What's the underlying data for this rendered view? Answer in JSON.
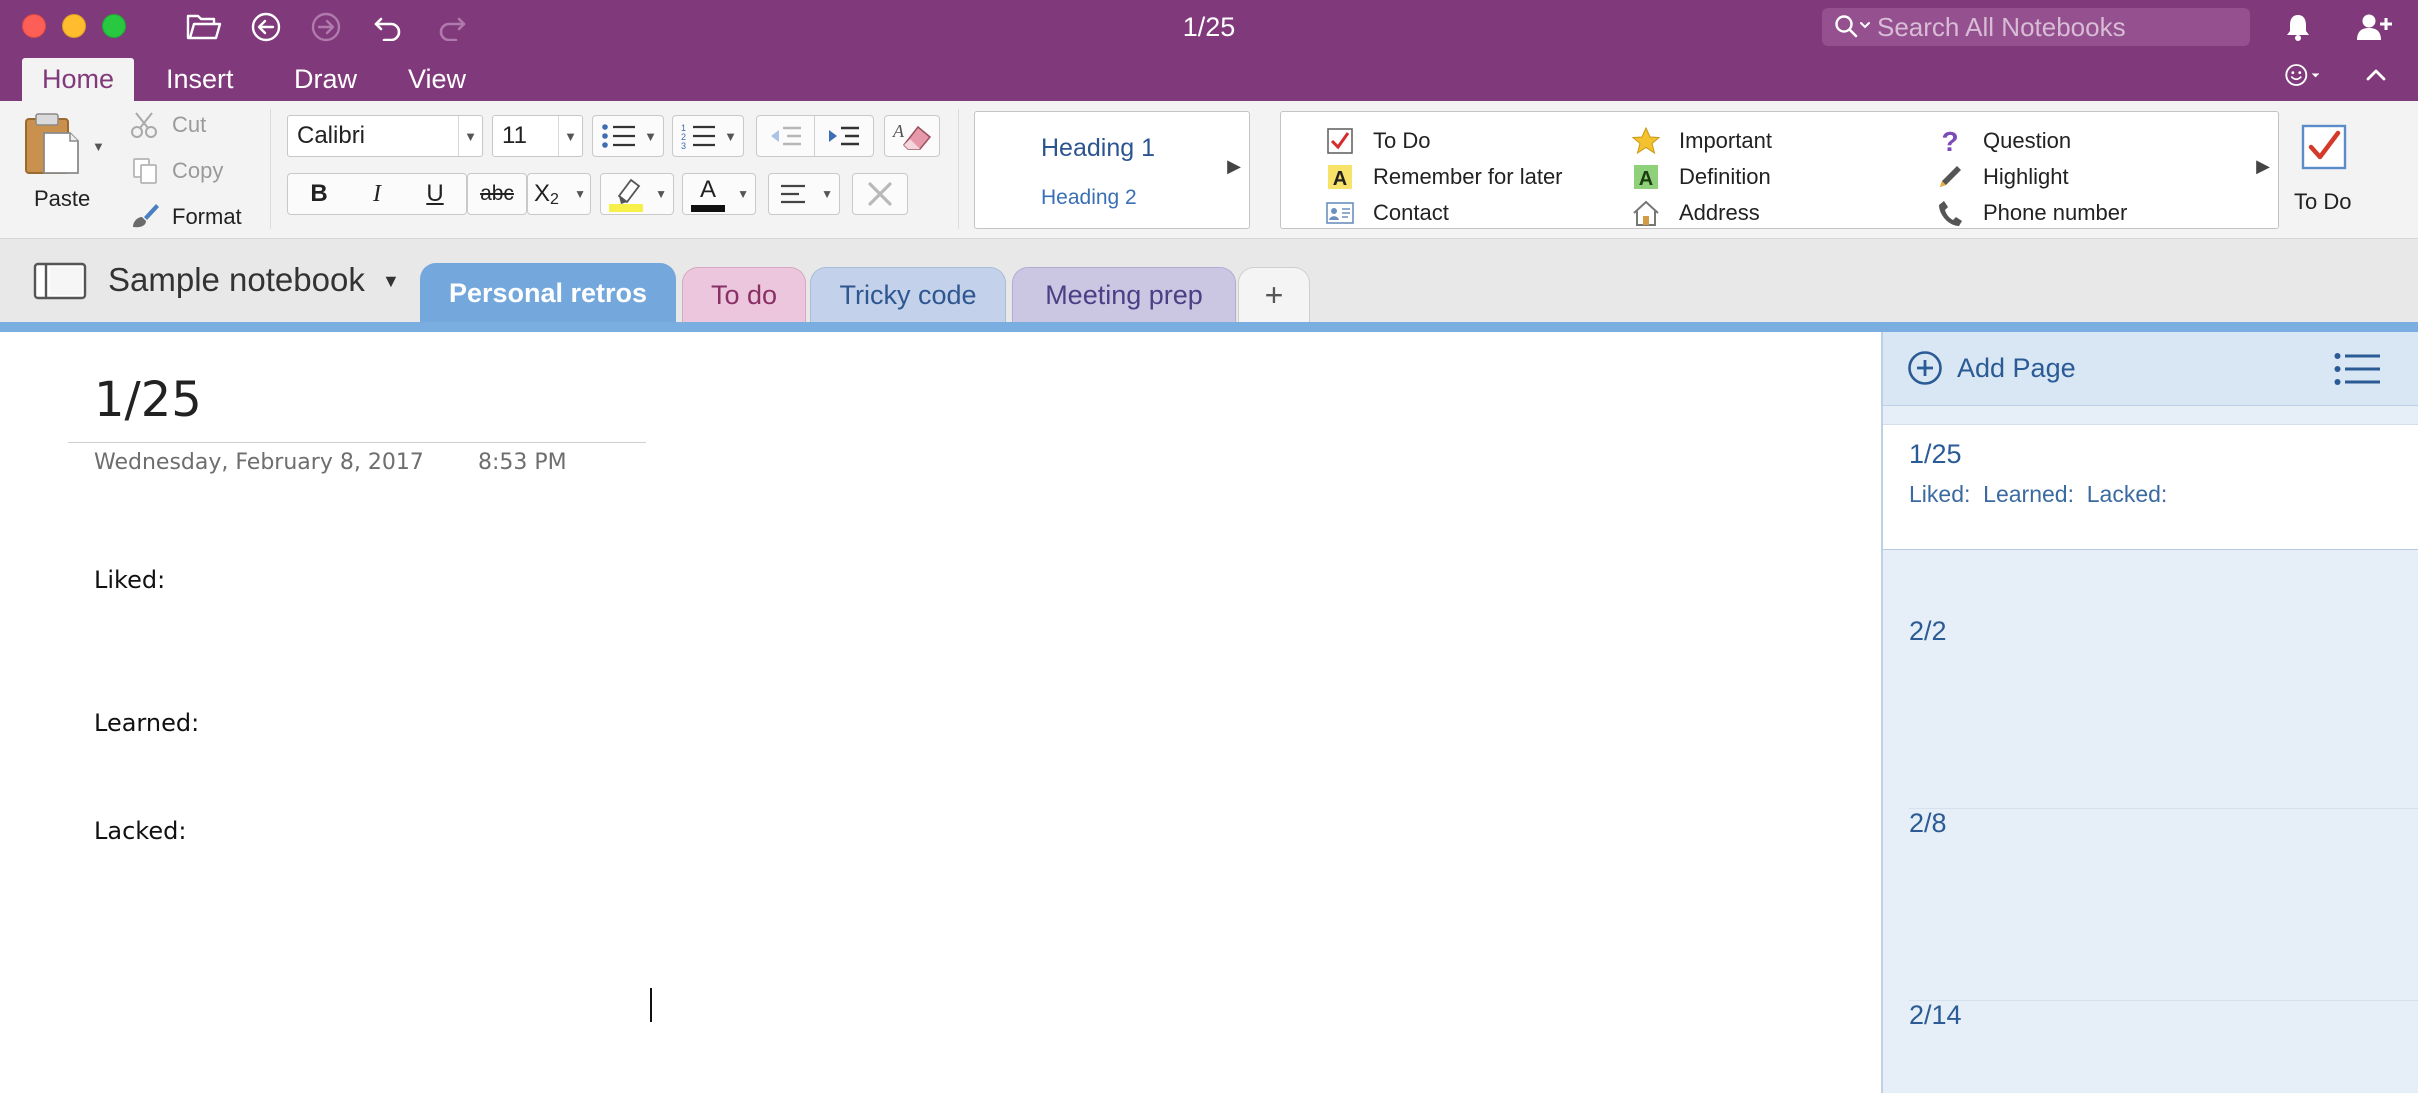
{
  "window": {
    "title": "1/25"
  },
  "search": {
    "placeholder": "Search All Notebooks"
  },
  "ribbon_tabs": [
    {
      "label": "Home",
      "active": true
    },
    {
      "label": "Insert",
      "active": false
    },
    {
      "label": "Draw",
      "active": false
    },
    {
      "label": "View",
      "active": false
    }
  ],
  "clipboard": {
    "paste": "Paste",
    "cut": "Cut",
    "copy": "Copy",
    "format": "Format"
  },
  "font": {
    "family": "Calibri",
    "size": "11",
    "strikethrough_glyph": "abc",
    "bold": "B",
    "italic": "I",
    "underline": "U",
    "subscript": "X",
    "subscript_digit": "2",
    "font_color_glyph": "A"
  },
  "styles": {
    "heading1": "Heading 1",
    "heading2": "Heading 2"
  },
  "tags": [
    {
      "label": "To Do",
      "icon": "checkbox-icon"
    },
    {
      "label": "Remember for later",
      "icon": "highlight-a-icon"
    },
    {
      "label": "Contact",
      "icon": "contact-card-icon"
    },
    {
      "label": "Important",
      "icon": "star-icon"
    },
    {
      "label": "Definition",
      "icon": "definition-a-icon"
    },
    {
      "label": "Address",
      "icon": "house-icon"
    },
    {
      "label": "Question",
      "icon": "question-icon"
    },
    {
      "label": "Highlight",
      "icon": "pen-icon"
    },
    {
      "label": "Phone number",
      "icon": "phone-icon"
    }
  ],
  "todo_button": {
    "label": "To Do"
  },
  "notebook": {
    "name": "Sample notebook"
  },
  "sections": [
    {
      "label": "Personal retros",
      "active": true,
      "color": "#74a8dc"
    },
    {
      "label": "To do",
      "active": false,
      "color": "#ecc6dc"
    },
    {
      "label": "Tricky code",
      "active": false,
      "color": "#c3d2ea"
    },
    {
      "label": "Meeting prep",
      "active": false,
      "color": "#cbc6e2"
    }
  ],
  "add_section_label": "+",
  "page": {
    "title": "1/25",
    "date": "Wednesday, February 8, 2017",
    "time": "8:53 PM",
    "lines": [
      "Liked:",
      "Learned:",
      "Lacked:"
    ]
  },
  "pane": {
    "add_page": "Add Page",
    "pages": [
      {
        "title": "1/25",
        "preview": "Liked:  Learned:  Lacked:",
        "selected": true
      },
      {
        "title": "2/2",
        "preview": "",
        "selected": false
      },
      {
        "title": "2/8",
        "preview": "",
        "selected": false
      },
      {
        "title": "2/14",
        "preview": "",
        "selected": false
      }
    ]
  },
  "colors": {
    "accent": "#80397b",
    "section_line": "#7aaee0",
    "link_blue": "#2a5b95"
  }
}
